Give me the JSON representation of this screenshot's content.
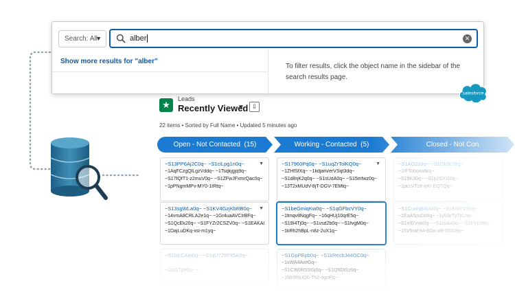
{
  "search": {
    "scope_label": "Search: All",
    "query": "alber",
    "show_more": "Show more results for \"alber\"",
    "hint": "To filter results, click the object name in the sidebar of the search results page."
  },
  "brand": {
    "logo_text": "salesforce",
    "accent": "#0b5cab",
    "logo_color": "#1798c1"
  },
  "list_view": {
    "object": "Leads",
    "title": "Recently Viewed",
    "meta": "22 items • Sorted by Full Name • Updated 5 minutes ago"
  },
  "stages": [
    {
      "label": "Open - Not Contacted",
      "count": "(15)"
    },
    {
      "label": "Working - Contacted",
      "count": "(5)"
    },
    {
      "label": "Closed - Not Con",
      "count": ""
    }
  ],
  "columns": [
    {
      "cards": [
        {
          "title": "~S13PP6Aj2C0q~ ~S1ciLpg1n0q~",
          "lines": [
            "~1AqFCzgQlLgzVddq~ ~1Tsqkjgjq9q~",
            "~S17fQfT1-z2muV0q~ ~S1ZFwJFxmrQac0q~ ...",
            "~1pPNgmMPv-MY0-1tRtq~"
          ]
        },
        {
          "title": "~S13sgWLa0q~ ~S1KV4GzjKbRB0q~",
          "lines": [
            "~14vmA8CRLA2e1q~ ~1Gr4uaAVCIrBFq~",
            "~S1QcEk20q~ ~S1FYZr2CSZV0q~ ~S1EAKA8n...",
            "~1DajLuDKq-xsl-m1yq~"
          ]
        },
        {
          "title": "~S1lsLCAm0q~ ~S1qU7Z8Fk5A0q~",
          "lines": [
            "",
            "~1sq1Tp90q~ ~",
            ""
          ]
        }
      ]
    },
    {
      "cards": [
        {
          "title": "~S17960Pq0q~ ~S1uqZrTolKQ0q~",
          "lines": [
            "~1ZHfSfXq~ ~1kdjam/erVSqt3dq~",
            "~S1d8rjK2q0q~ ~S1sUdA0q~ ~S15mfwz0q~",
            "~13T2xMUdV-8jT-DGV-7EMtq~"
          ]
        },
        {
          "title": "~S1beGmiqKw0q~ ~S1qGFbcVY0q~",
          "lines": [
            "~1fmqv8NqgFq~ ~16qHUj10qrE5q~",
            "~S19I4Tj0q~ ~S1vsd2b0q~ ~S1fvgM0q~",
            "~1kRh2hBpL-n8z-2uX1q~"
          ]
        },
        {
          "title": "~S1GpPEpb0q~ ~S1kRecbJ44OC0q~",
          "lines": [
            "~1vWA4AwfGq~",
            "~S1CW0RSSGj0q~ ~S1Q9DfSz0q~",
            "~1McRhUO0-Th2-dgnPq~"
          ]
        }
      ]
    },
    {
      "cards": [
        {
          "title": "~S1AO2z0q~ ~S1Ob5t7Bq~",
          "lines": [
            "~1rFTobsea6kq~",
            "~S19K30q~ ~S1p2GXG0q~",
            "~1pccVTztr-kKr-EQTQq~"
          ]
        },
        {
          "title": "~S1Cuxhj8Xov0q~ ~S1KNYVSkq~",
          "lines": [
            "~1EaA5psDd8q~ ~1y53cTyTkLnq~",
            "~S1eIDVwk0q~ ~S1cuA40q~ ~S1FVp9Bq~",
            "~15V5raF94-8Da-a8f-5f0D8q~"
          ]
        }
      ]
    }
  ]
}
